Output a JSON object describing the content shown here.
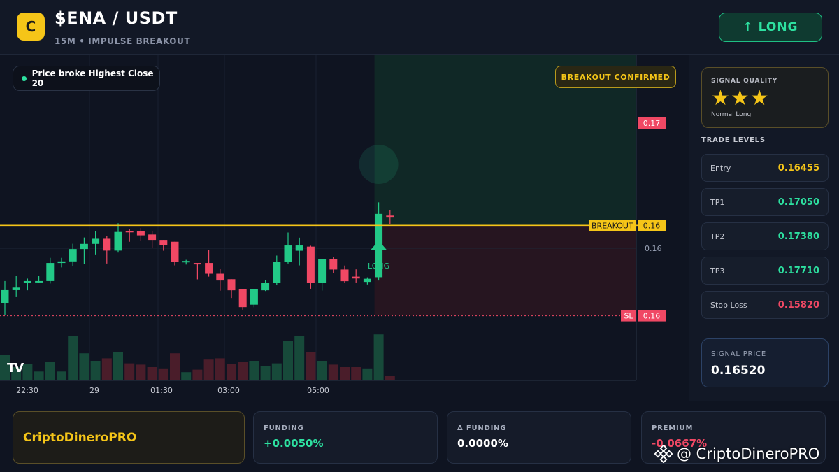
{
  "header": {
    "logo_letter": "C",
    "pair": "$ENA / USDT",
    "subtitle": "15M • IMPULSE BREAKOUT",
    "long_button": "↑ LONG"
  },
  "chart": {
    "chip_label": "Price broke Highest Close 20",
    "confirmed_label": "BREAKOUT CONFIRMED",
    "breakout_label": "BREAKOUT",
    "breakout_price": "0.16",
    "current_price": "0.17",
    "sl_label": "SL",
    "sl_price": "0.16",
    "grid_price": "0.16",
    "long_marker": "LONG",
    "tv_logo": "TV",
    "time_labels": [
      "22:30",
      "29",
      "01:30",
      "03:00",
      "05:00"
    ]
  },
  "chart_data": {
    "type": "candlestick",
    "ylim": [
      0.157,
      0.174
    ],
    "levels": {
      "breakout": 0.16455,
      "stop_loss": 0.1582
    },
    "candles": [
      {
        "o": 0.15908,
        "h": 0.16064,
        "l": 0.15826,
        "c": 0.16,
        "v": 0.4
      },
      {
        "o": 0.16,
        "h": 0.16098,
        "l": 0.15951,
        "c": 0.16018,
        "v": 0.2
      },
      {
        "o": 0.16051,
        "h": 0.16081,
        "l": 0.15999,
        "c": 0.16064,
        "v": 0.25
      },
      {
        "o": 0.16064,
        "h": 0.16098,
        "l": 0.16051,
        "c": 0.16064,
        "v": 0.13
      },
      {
        "o": 0.16064,
        "h": 0.16227,
        "l": 0.16047,
        "c": 0.16191,
        "v": 0.28
      },
      {
        "o": 0.16191,
        "h": 0.16227,
        "l": 0.1616,
        "c": 0.16202,
        "v": 0.13
      },
      {
        "o": 0.16202,
        "h": 0.16326,
        "l": 0.1617,
        "c": 0.16289,
        "v": 0.7
      },
      {
        "o": 0.16289,
        "h": 0.1637,
        "l": 0.16182,
        "c": 0.16325,
        "v": 0.42
      },
      {
        "o": 0.16325,
        "h": 0.16414,
        "l": 0.16251,
        "c": 0.16361,
        "v": 0.3
      },
      {
        "o": 0.16361,
        "h": 0.16381,
        "l": 0.16187,
        "c": 0.16278,
        "v": 0.34
      },
      {
        "o": 0.16278,
        "h": 0.1647,
        "l": 0.16264,
        "c": 0.16409,
        "v": 0.44
      },
      {
        "o": 0.16416,
        "h": 0.16431,
        "l": 0.1634,
        "c": 0.16409,
        "v": 0.26
      },
      {
        "o": 0.16416,
        "h": 0.16436,
        "l": 0.16346,
        "c": 0.16385,
        "v": 0.24
      },
      {
        "o": 0.16391,
        "h": 0.16414,
        "l": 0.163,
        "c": 0.16353,
        "v": 0.2
      },
      {
        "o": 0.16353,
        "h": 0.16353,
        "l": 0.16277,
        "c": 0.16315,
        "v": 0.18
      },
      {
        "o": 0.1634,
        "h": 0.1634,
        "l": 0.16174,
        "c": 0.16198,
        "v": 0.42
      },
      {
        "o": 0.16198,
        "h": 0.16213,
        "l": 0.1618,
        "c": 0.16205,
        "v": 0.12
      },
      {
        "o": 0.16191,
        "h": 0.16191,
        "l": 0.16076,
        "c": 0.16181,
        "v": 0.16
      },
      {
        "o": 0.16191,
        "h": 0.1628,
        "l": 0.16095,
        "c": 0.16115,
        "v": 0.32
      },
      {
        "o": 0.16115,
        "h": 0.1615,
        "l": 0.15996,
        "c": 0.16068,
        "v": 0.34
      },
      {
        "o": 0.16077,
        "h": 0.16077,
        "l": 0.15945,
        "c": 0.15999,
        "v": 0.25
      },
      {
        "o": 0.16009,
        "h": 0.16009,
        "l": 0.15863,
        "c": 0.15881,
        "v": 0.28
      },
      {
        "o": 0.15898,
        "h": 0.16009,
        "l": 0.1588,
        "c": 0.16009,
        "v": 0.3
      },
      {
        "o": 0.15999,
        "h": 0.16073,
        "l": 0.15994,
        "c": 0.1605,
        "v": 0.22
      },
      {
        "o": 0.1605,
        "h": 0.16243,
        "l": 0.16034,
        "c": 0.16197,
        "v": 0.26
      },
      {
        "o": 0.16197,
        "h": 0.16405,
        "l": 0.16187,
        "c": 0.16314,
        "v": 0.62
      },
      {
        "o": 0.16277,
        "h": 0.16369,
        "l": 0.16174,
        "c": 0.16314,
        "v": 0.7
      },
      {
        "o": 0.16306,
        "h": 0.16312,
        "l": 0.1601,
        "c": 0.1605,
        "v": 0.44
      },
      {
        "o": 0.1605,
        "h": 0.16081,
        "l": 0.15997,
        "c": 0.16217,
        "v": 0.3
      },
      {
        "o": 0.16217,
        "h": 0.16232,
        "l": 0.16118,
        "c": 0.16145,
        "v": 0.24
      },
      {
        "o": 0.16145,
        "h": 0.16173,
        "l": 0.1605,
        "c": 0.16063,
        "v": 0.2
      },
      {
        "o": 0.16095,
        "h": 0.16146,
        "l": 0.16054,
        "c": 0.16082,
        "v": 0.2
      },
      {
        "o": 0.16058,
        "h": 0.1609,
        "l": 0.1604,
        "c": 0.1608,
        "v": 0.18
      },
      {
        "o": 0.16091,
        "h": 0.16617,
        "l": 0.16068,
        "c": 0.16536,
        "v": 0.72
      },
      {
        "o": 0.16524,
        "h": 0.16563,
        "l": 0.16463,
        "c": 0.1651,
        "v": 0.06
      }
    ]
  },
  "panel": {
    "quality_title": "SIGNAL QUALITY",
    "stars": "★★★",
    "quality_sub": "Normal Long",
    "levels_title": "TRADE LEVELS",
    "levels": [
      {
        "label": "Entry",
        "value": "0.16455",
        "color": "#f5c518"
      },
      {
        "label": "TP1",
        "value": "0.17050",
        "color": "#2de0a0"
      },
      {
        "label": "TP2",
        "value": "0.17380",
        "color": "#2de0a0"
      },
      {
        "label": "TP3",
        "value": "0.17710",
        "color": "#2de0a0"
      },
      {
        "label": "Stop Loss",
        "value": "0.15820",
        "color": "#f04864"
      }
    ],
    "signal_price_title": "SIGNAL PRICE",
    "signal_price": "0.16520"
  },
  "footer": {
    "brand": "CriptoDineroPRO",
    "stats": [
      {
        "title": "FUNDING",
        "value": "+0.0050%",
        "color": "#2de0a0"
      },
      {
        "title": "Δ FUNDING",
        "value": "0.0000%",
        "color": "#ffffff"
      },
      {
        "title": "PREMIUM",
        "value": "-0.0667%",
        "color": "#f04864"
      }
    ],
    "watermark": "@ CriptoDineroPRO"
  },
  "colors": {
    "up": "#22c987",
    "down": "#f04864",
    "accent": "#f5c518"
  }
}
